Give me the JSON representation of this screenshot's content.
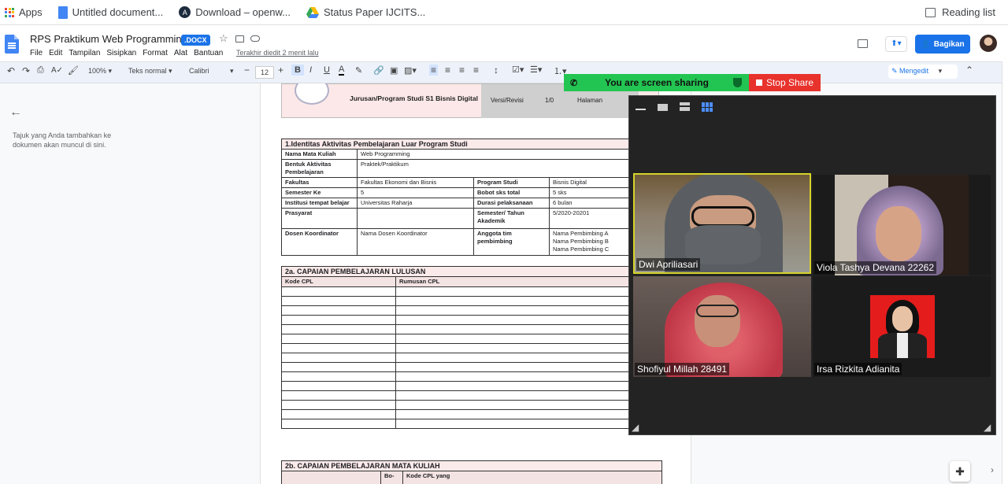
{
  "bookmarks": [
    {
      "label": "Apps",
      "icon": "apps-grid-icon"
    },
    {
      "label": "Untitled document...",
      "icon": "docs-icon"
    },
    {
      "label": "Download – openw...",
      "icon": "openwrt-icon"
    },
    {
      "label": "Status Paper IJCITS...",
      "icon": "drive-icon"
    }
  ],
  "reading_list": "Reading list",
  "doc": {
    "title": "RPS Praktikum Web Programming",
    "badge": ".DOCX",
    "menus": [
      "File",
      "Edit",
      "Tampilan",
      "Sisipkan",
      "Format",
      "Alat",
      "Bantuan"
    ],
    "last_edit": "Terakhir diedit 2 menit lalu",
    "share_label": "Bagikan"
  },
  "toolbar": {
    "zoom": "100%",
    "style": "Teks normal",
    "font": "Calibri",
    "size": "12",
    "mode": "Mengedit"
  },
  "sidebar": {
    "outline_hint": "Tajuk yang Anda tambahkan ke dokumen akan muncul di sini."
  },
  "page": {
    "header_program": "Jurusan/Program Studi S1 Bisnis Digital",
    "header_version_label": "Versi/Revisi",
    "header_version": "1/0",
    "header_page": "Halaman",
    "section1_title": "1.Identitas Aktivitas Pembelajaran Luar Program Studi",
    "rows": [
      {
        "k": "Nama Mata Kuliah",
        "v": "Web Programming",
        "k2": "",
        "v2": ""
      },
      {
        "k": "Bentuk Aktivitas Pembelajaran",
        "v": "Praktek/Praktikum",
        "k2": "",
        "v2": ""
      },
      {
        "k": "Fakultas",
        "v": "Fakultas Ekonomi dan Bisnis",
        "k2": "Program Studi",
        "v2": "Bisnis Digital"
      },
      {
        "k": "Semester Ke",
        "v": "5",
        "k2": "Bobot sks total",
        "v2": "5 sks"
      },
      {
        "k": "Institusi tempat belajar",
        "v": "Universitas Raharja",
        "k2": "Durasi pelaksanaan",
        "v2": "6 bulan"
      },
      {
        "k": "Prasyarat",
        "v": "",
        "k2": "Semester/ Tahun Akademik",
        "v2": "5/2020-20201"
      },
      {
        "k": "Dosen Koordinator",
        "v": "Nama Dosen Koordinator",
        "k2": "Anggota tim pembimbing",
        "v2": "Nama Pembimbing A\nNama Pembimbing B\nNama Pembimbing C"
      }
    ],
    "section2a_title": "2a. CAPAIAN PEMBELAJARAN LULUSAN",
    "section2a_cols": [
      "Kode CPL",
      "Rumusan CPL"
    ],
    "section2b_title": "2b. CAPAIAN PEMBELAJARAN MATA KULIAH",
    "section2b_cols": [
      "",
      "Bo-",
      "Kode CPL yang"
    ]
  },
  "screen_share": {
    "status": "You are screen sharing",
    "stop": "Stop Share"
  },
  "participants": [
    {
      "name": "Dwi Apriliasari"
    },
    {
      "name": "Viola Tashya Devana 22262"
    },
    {
      "name": "Shofiyul Millah 28491"
    },
    {
      "name": "Irsa Rizkita Adianita"
    }
  ]
}
